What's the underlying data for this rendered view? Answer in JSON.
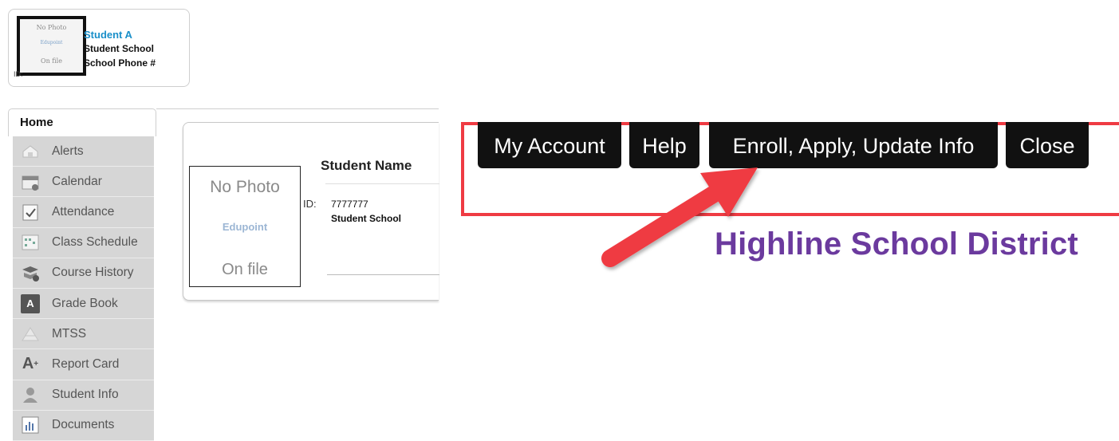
{
  "student_card": {
    "photo_lines": [
      "No Photo",
      "Edupoint",
      "On file"
    ],
    "id_label": "ID:",
    "name": "Student A",
    "school": "Student School",
    "phone": "School Phone #"
  },
  "home_tab": {
    "label": "Home"
  },
  "sidebar": {
    "items": [
      {
        "label": "Alerts",
        "icon": "alerts-icon"
      },
      {
        "label": "Calendar",
        "icon": "calendar-icon"
      },
      {
        "label": "Attendance",
        "icon": "attendance-icon"
      },
      {
        "label": "Class Schedule",
        "icon": "class-schedule-icon"
      },
      {
        "label": "Course History",
        "icon": "course-history-icon"
      },
      {
        "label": "Grade Book",
        "icon": "grade-book-icon"
      },
      {
        "label": "MTSS",
        "icon": "mtss-icon"
      },
      {
        "label": "Report Card",
        "icon": "report-card-icon"
      },
      {
        "label": "Student Info",
        "icon": "student-info-icon"
      },
      {
        "label": "Documents",
        "icon": "documents-icon"
      }
    ]
  },
  "info_panel": {
    "photo_lines": [
      "No Photo",
      "Edupoint",
      "On file"
    ],
    "title": "Student Name",
    "id_label": "ID:",
    "id_value": "7777777",
    "school": "Student School"
  },
  "top_nav": {
    "my_account": "My Account",
    "help": "Help",
    "enroll": "Enroll, Apply, Update Info",
    "close": "Close"
  },
  "district": "Highline School District",
  "colors": {
    "accent_link": "#1a8fc9",
    "callout_red": "#ef3b43",
    "district_purple": "#6b3a9e",
    "nav_button_bg": "#111111"
  }
}
